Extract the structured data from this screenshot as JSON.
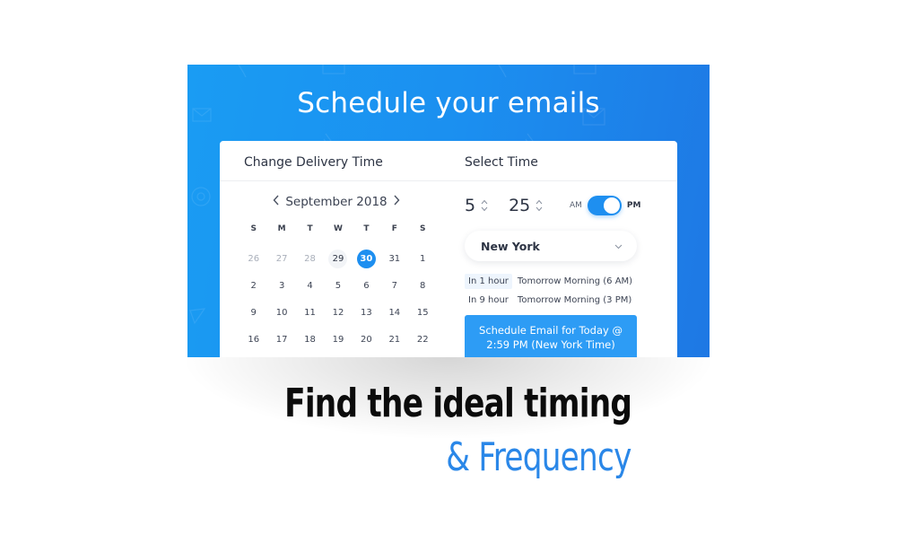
{
  "banner": {
    "title": "Schedule your emails",
    "background_gradient": [
      "#1a9cf3",
      "#1e78e4"
    ],
    "background_icons": [
      "envelope-icon",
      "paperclip-icon",
      "at-sign-icon",
      "paper-plane-icon",
      "pen-icon"
    ]
  },
  "delivery": {
    "header": "Change Delivery Time",
    "month_label": "September 2018",
    "prev_icon": "chevron-left-icon",
    "next_icon": "chevron-right-icon",
    "weekdays": [
      "S",
      "M",
      "T",
      "W",
      "T",
      "F",
      "S"
    ],
    "weeks": [
      [
        {
          "d": "26",
          "state": "muted"
        },
        {
          "d": "27",
          "state": "muted"
        },
        {
          "d": "28",
          "state": "muted"
        },
        {
          "d": "29",
          "state": "hover"
        },
        {
          "d": "30",
          "state": "selected"
        },
        {
          "d": "31",
          "state": ""
        },
        {
          "d": "1",
          "state": ""
        }
      ],
      [
        {
          "d": "2",
          "state": ""
        },
        {
          "d": "3",
          "state": ""
        },
        {
          "d": "4",
          "state": ""
        },
        {
          "d": "5",
          "state": ""
        },
        {
          "d": "6",
          "state": ""
        },
        {
          "d": "7",
          "state": ""
        },
        {
          "d": "8",
          "state": ""
        }
      ],
      [
        {
          "d": "9",
          "state": ""
        },
        {
          "d": "10",
          "state": ""
        },
        {
          "d": "11",
          "state": ""
        },
        {
          "d": "12",
          "state": ""
        },
        {
          "d": "13",
          "state": ""
        },
        {
          "d": "14",
          "state": ""
        },
        {
          "d": "15",
          "state": ""
        }
      ],
      [
        {
          "d": "16",
          "state": ""
        },
        {
          "d": "17",
          "state": ""
        },
        {
          "d": "18",
          "state": ""
        },
        {
          "d": "19",
          "state": ""
        },
        {
          "d": "20",
          "state": ""
        },
        {
          "d": "21",
          "state": ""
        },
        {
          "d": "22",
          "state": ""
        }
      ]
    ],
    "selected_date": "30",
    "accent_color": "#1e8ff0"
  },
  "time": {
    "header": "Select Time",
    "hour": "5",
    "minute": "25",
    "am_label": "AM",
    "pm_label": "PM",
    "period": "PM",
    "timezone": "New York",
    "quick_options": [
      {
        "chip": "In 1 hour",
        "label": "Tomorrow Morning (6 AM)",
        "selected": true
      },
      {
        "chip": "In 9 hour",
        "label": "Tomorrow Morning (3 PM)",
        "selected": false
      }
    ],
    "schedule_button": {
      "line1": "Schedule Email for Today @",
      "line2": "2:59 PM (New York Time)",
      "color": "#2d9cf5"
    }
  },
  "caption": {
    "headline": "Find the ideal timing",
    "subheadline": "& Frequency",
    "subheadline_color": "#2a87e8"
  }
}
